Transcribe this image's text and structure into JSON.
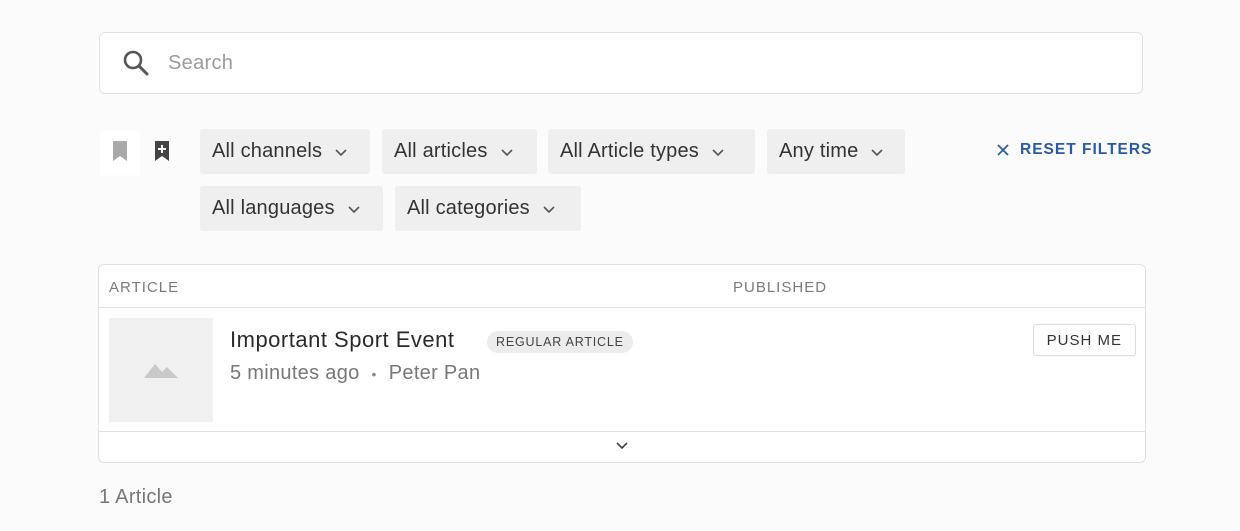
{
  "search": {
    "placeholder": "Search",
    "icon": "search-icon"
  },
  "toolbar": {
    "bookmark_icon": "bookmark-icon",
    "add_bookmark_icon": "bookmark-add-icon",
    "filters": [
      {
        "label": "All channels"
      },
      {
        "label": "All articles"
      },
      {
        "label": "All Article types"
      },
      {
        "label": "Any time"
      },
      {
        "label": "All languages"
      },
      {
        "label": "All categories"
      }
    ],
    "reset_label": "RESET FILTERS"
  },
  "table": {
    "columns": {
      "article": "ARTICLE",
      "published": "PUBLISHED"
    },
    "rows": [
      {
        "title": "Important Sport Event",
        "type": "REGULAR ARTICLE",
        "time": "5 minutes ago",
        "separator": "•",
        "author": "Peter Pan",
        "action": "PUSH ME"
      }
    ]
  },
  "footer": {
    "count": "1 Article"
  },
  "colors": {
    "accent": "#2a5aa5",
    "chip_bg": "#efefef",
    "page_bg": "#fbfbfb"
  }
}
